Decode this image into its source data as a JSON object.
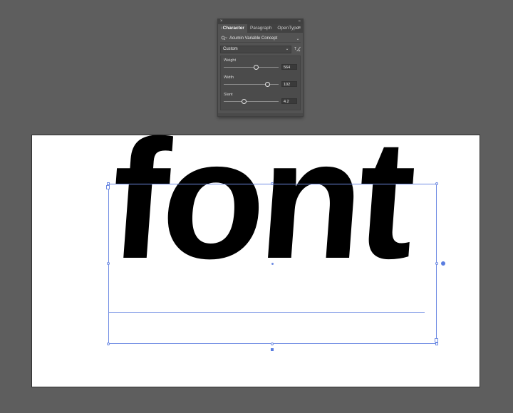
{
  "panel": {
    "close_glyph": "×",
    "grip_glyph": "«",
    "tabs": [
      {
        "label": "Character",
        "active": true
      },
      {
        "label": "Paragraph",
        "active": false
      },
      {
        "label": "OpenType",
        "active": false
      }
    ],
    "menu_icon": "hamburger-icon",
    "font_family": "Acumin Variable Concept",
    "font_style": "Custom",
    "variable_font_icon": "variable-font-icon",
    "axes": [
      {
        "label": "Weight",
        "value": "564",
        "fraction": 0.58
      },
      {
        "label": "Width",
        "value": "102",
        "fraction": 0.79
      },
      {
        "label": "Slant",
        "value": "4.2",
        "fraction": 0.36
      }
    ]
  },
  "artboard": {
    "text": "font",
    "selection_color": "#6e8be3",
    "background": "#ffffff"
  },
  "colors": {
    "workspace": "#5e5e5e",
    "panel": "#535353",
    "accent": "#5a7de0"
  }
}
